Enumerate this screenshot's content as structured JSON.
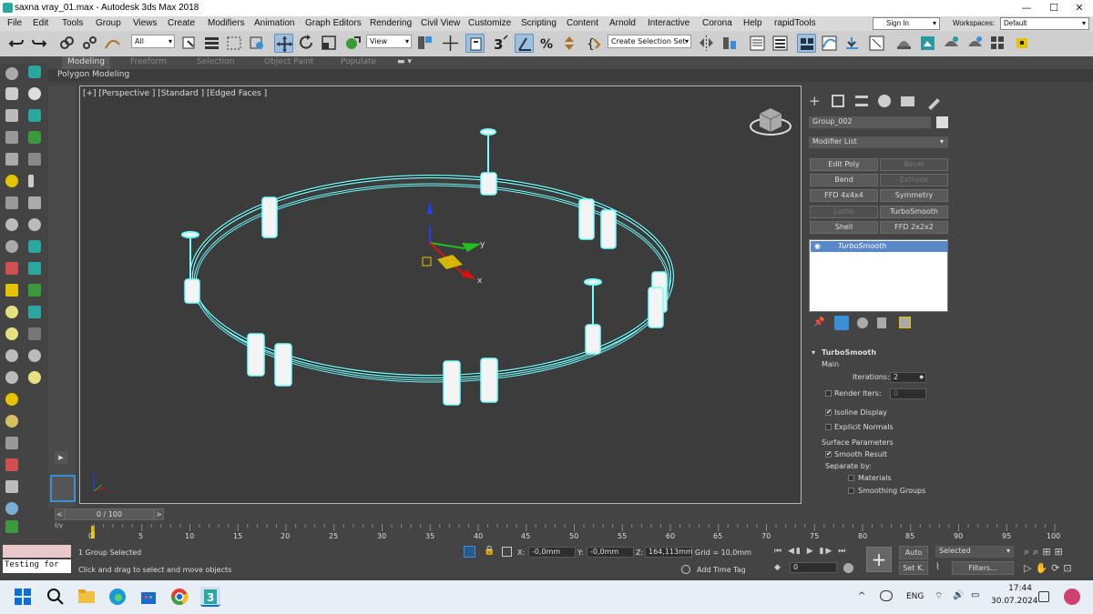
{
  "window": {
    "title": "saxna vray_01.max - Autodesk 3ds Max 2018",
    "min": "—",
    "max": "☐",
    "close": "✕"
  },
  "menu": {
    "items": [
      "File",
      "Edit",
      "Tools",
      "Group",
      "Views",
      "Create",
      "Modifiers",
      "Animation",
      "Graph Editors",
      "Rendering",
      "Civil View",
      "Customize",
      "Scripting",
      "Content",
      "Arnold",
      "Interactive",
      "Corona",
      "Help",
      "rapidTools"
    ],
    "sign_in": "Sign In",
    "workspaces_label": "Workspaces:",
    "workspace_value": "Default"
  },
  "toolbar": {
    "filter_value": "All",
    "ref_coord_value": "View",
    "selection_set_value": "Create Selection Set"
  },
  "ribbon": {
    "tabs": [
      "Modeling",
      "Freeform",
      "Selection",
      "Object Paint",
      "Populate"
    ],
    "active_tab": "Modeling",
    "sub_label": "Polygon Modeling"
  },
  "viewport": {
    "label": "[+] [Perspective ] [Standard ] [Edged Faces ]",
    "axis_x": "x",
    "axis_y": "y"
  },
  "command_panel": {
    "object_name": "Group_002",
    "modifier_list": "Modifier List",
    "buttons": [
      {
        "label": "Edit Poly",
        "enabled": true
      },
      {
        "label": "Bevel",
        "enabled": false
      },
      {
        "label": "Bend",
        "enabled": true
      },
      {
        "label": "Extrude",
        "enabled": false
      },
      {
        "label": "FFD 4x4x4",
        "enabled": true
      },
      {
        "label": "Symmetry",
        "enabled": true
      },
      {
        "label": "Lathe",
        "enabled": false
      },
      {
        "label": "TurboSmooth",
        "enabled": true
      },
      {
        "label": "Shell",
        "enabled": true
      },
      {
        "label": "FFD 2x2x2",
        "enabled": true
      }
    ],
    "stack_item": "TurboSmooth",
    "rollout_title": "TurboSmooth",
    "main_label": "Main",
    "iterations_label": "Iterations:",
    "iterations_value": "2",
    "render_iters_label": "Render Iters:",
    "render_iters_value": "0",
    "isoline_label": "Isoline Display",
    "isoline_checked": true,
    "explicit_normals_label": "Explicit Normals",
    "explicit_normals_checked": false,
    "surface_params_label": "Surface Parameters",
    "smooth_result_label": "Smooth Result",
    "smooth_result_checked": true,
    "separate_by_label": "Separate by:",
    "materials_label": "Materials",
    "smoothing_groups_label": "Smoothing Groups"
  },
  "timeline": {
    "frame_display": "0 / 100",
    "ticks": [
      "0",
      "5",
      "10",
      "15",
      "20",
      "25",
      "30",
      "35",
      "40",
      "45",
      "50",
      "55",
      "60",
      "65",
      "70",
      "75",
      "80",
      "85",
      "90",
      "95",
      "100"
    ]
  },
  "status": {
    "script_text": "Testing for",
    "selection": "1 Group Selected",
    "prompt": "Click and drag to select and move objects",
    "x_label": "X:",
    "x_value": "-0,0mm",
    "y_label": "Y:",
    "y_value": "-0,0mm",
    "z_label": "Z:",
    "z_value": "164,113mm",
    "grid": "Grid = 10,0mm",
    "add_time_tag": "Add Time Tag",
    "auto": "Auto",
    "set_k": "Set K.",
    "selected": "Selected",
    "filters": "Filters...",
    "frame_value": "0"
  },
  "taskbar": {
    "language": "ENG",
    "time": "17:44",
    "date": "30.07.2024"
  }
}
